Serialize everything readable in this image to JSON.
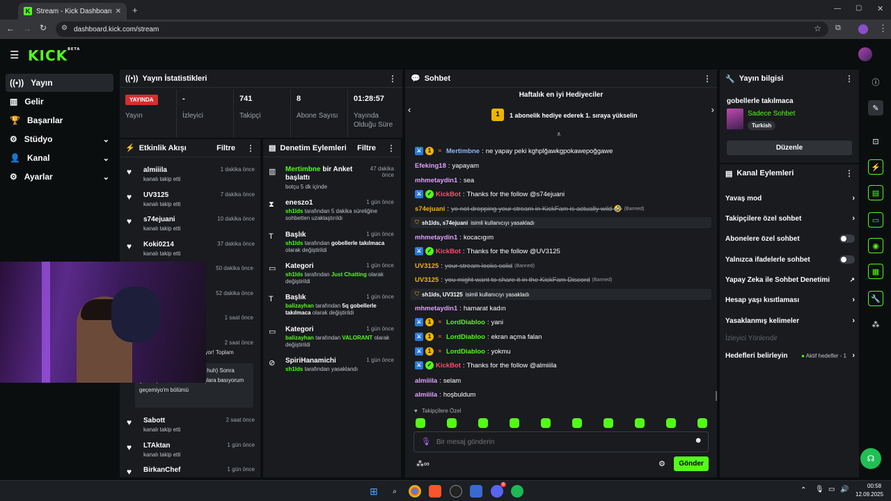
{
  "browser": {
    "tab_title": "Stream - Kick Dashboard",
    "url": "dashboard.kick.com/stream"
  },
  "header": {
    "logo": "KICK",
    "logo_sup": "BETA"
  },
  "nav": {
    "items": [
      {
        "label": "Yayın",
        "icon": "broadcast-icon"
      },
      {
        "label": "Gelir",
        "icon": "chart-icon"
      },
      {
        "label": "Başarılar",
        "icon": "trophy-icon"
      },
      {
        "label": "Stüdyo",
        "icon": "gear-icon"
      },
      {
        "label": "Kanal",
        "icon": "person-icon"
      },
      {
        "label": "Ayarlar",
        "icon": "settings-icon"
      }
    ]
  },
  "stats": {
    "title": "Yayın İstatistikleri",
    "live_badge": "YAYINDA",
    "live_label": "Yayın",
    "viewers_value": "-",
    "viewers_label": "İzleyici",
    "followers_value": "741",
    "followers_label": "Takipçi",
    "subs_value": "8",
    "subs_label": "Abone Sayısı",
    "uptime_value": "01:28:57",
    "uptime_label": "Yayında Olduğu Süre"
  },
  "activity": {
    "title": "Etkinlik Akışı",
    "filter": "Filtre",
    "items": [
      {
        "name": "almiiila",
        "sub": "kanalı takip etti",
        "time": "1 dakika önce"
      },
      {
        "name": "UV3125",
        "sub": "kanalı takip etti",
        "time": "7 dakika önce"
      },
      {
        "name": "s74ejuani",
        "sub": "kanalı takip etti",
        "time": "10 dakika önce"
      },
      {
        "name": "Koki0214",
        "sub": "kanalı takip etti",
        "time": "37 dakika önce"
      }
    ],
    "hidden_times": [
      "50 dakika önce",
      "52 dakika önce",
      "1 saat önce",
      "2 saat önce"
    ],
    "partial_tail": "uyor! Toplam",
    "msg_text": "yo' kömürü iki dönümü (Uh huh) Sonra göremiyom önümü Tüm tuşlara basıyorum geçemiyo'm bölümü",
    "items_bottom": [
      {
        "name": "Sabott",
        "sub": "kanalı takip etti",
        "time": "2 saat önce"
      },
      {
        "name": "LTAktan",
        "sub": "kanalı takip etti",
        "time": "1 gün önce"
      },
      {
        "name": "BirkanChef",
        "sub": "",
        "time": "1 gün önce"
      }
    ]
  },
  "moderation": {
    "title": "Denetim Eylemleri",
    "filter": "Filtre",
    "items": [
      {
        "title_g": "Mertimbne",
        "title": " bir Anket başlattı",
        "sub": "botçu 5 dk içinde",
        "time": "47 dakika önce"
      },
      {
        "title": "eneszo1",
        "sub_g": "sh1lds",
        "sub": " tarafından 5 dakika süreliğine sohbetten uzaklaştırıldı",
        "time": "1 gün önce"
      },
      {
        "title": "Başlık",
        "sub_g": "sh1lds",
        "sub": " tarafından ",
        "sub_b": "gobellerle takılmaca",
        "sub2": " olarak değiştirildi",
        "time": "1 gün önce"
      },
      {
        "title": "Kategori",
        "sub_g": "sh1lds",
        "sub": " tarafından ",
        "sub_gb": "Just Chatting",
        "sub2": " olarak değiştirildi",
        "time": "1 gün önce"
      },
      {
        "title": "Başlık",
        "sub_g": "balizayhan",
        "sub": " tarafından ",
        "sub_b": "5q gobellerle takılmaca",
        "sub2": " olarak değiştirildi",
        "time": "1 gün önce"
      },
      {
        "title": "Kategori",
        "sub_g": "balizayhan",
        "sub": " tarafından ",
        "sub_gb": "VALORANT",
        "sub2": " olarak değiştirildi",
        "time": "1 gün önce"
      },
      {
        "title": "SpiriHanamichi",
        "sub_g": "sh1lds",
        "sub": " tarafından yasaklandı",
        "time": "1 gün önce"
      }
    ]
  },
  "chat": {
    "title": "Sohbet",
    "gifters_title": "Haftalık en iyi Hediyeciler",
    "gifters_rank": "1",
    "gifters_text": "1 abonelik hediye ederek 1. sıraya yükselin",
    "messages": [
      {
        "user": "Mertimbne",
        "text": "ne yapay peki kghplğawkgpokawepoğgawe",
        "color": "#8fb8ff",
        "badges": "modsubgift"
      },
      {
        "user": "Efeking18",
        "text": "yapayam",
        "color": "#e0a0ff",
        "badges": ""
      },
      {
        "user": "mhmetaydin1",
        "text": "sea",
        "color": "#e0a0ff",
        "badges": ""
      },
      {
        "user": "KickBot",
        "text": "Thanks for the follow @s74ejuani",
        "color": "#ff4d6d",
        "badges": "modver"
      },
      {
        "user": "s74ejuani",
        "text": "yo not dropping your stream in KickFam is actually wild 🤣",
        "color": "#f0b400",
        "badges": "",
        "deleted": true
      },
      {
        "user": "mhmetaydin1",
        "text": "kocacıgım",
        "color": "#e0a0ff",
        "badges": ""
      },
      {
        "user": "KickBot",
        "text": "Thanks for the follow @UV3125",
        "color": "#ff4d6d",
        "badges": "modver"
      },
      {
        "user": "UV3125",
        "text": "your stream looks solid",
        "color": "#f0b400",
        "badges": "",
        "deleted": true
      },
      {
        "user": "UV3125",
        "text": "you might want to share it in the KickFam Discord",
        "color": "#f0b400",
        "badges": "",
        "deleted": true
      },
      {
        "user": "mhmetaydin1",
        "text": "hamarat kadın",
        "color": "#e0a0ff",
        "badges": ""
      },
      {
        "user": "LordDiabloo",
        "text": "yani",
        "color": "#53fc18",
        "badges": "modsubgift"
      },
      {
        "user": "LordDiabloo",
        "text": "ekran açma falan",
        "color": "#53fc18",
        "badges": "modsubgift"
      },
      {
        "user": "LordDiabloo",
        "text": "yokmu",
        "color": "#53fc18",
        "badges": "modsubgift"
      },
      {
        "user": "KickBot",
        "text": "Thanks for the follow @almiiila",
        "color": "#ff4d6d",
        "badges": "modver"
      },
      {
        "user": "almiiila",
        "text": "selam",
        "color": "#e0a0ff",
        "badges": ""
      },
      {
        "user": "almiiila",
        "text": "hoşbuldum",
        "color": "#e0a0ff",
        "badges": ""
      }
    ],
    "banned_label": "(Banned)",
    "sys1_users": "sh1lds, s74ejuani",
    "sys1_text": " isimli kullanıcıyı yasakladı",
    "sys2_users": "sh1lds, UV3125",
    "sys2_text": " isimli kullanıcıyı yasakladı",
    "followers_only": "Takipçilere Özel",
    "input_placeholder": "Bir mesaj gönderin",
    "send": "Gönder"
  },
  "stream_info": {
    "title": "Yayın bilgisi",
    "stream_title": "gobellerle takılmaca",
    "category": "Sadece Sohbet",
    "language": "Turkish",
    "edit": "Düzenle"
  },
  "channel_actions": {
    "title": "Kanal Eylemleri",
    "slow_mode": "Yavaş mod",
    "followers_chat": "Takipçilere özel sohbet",
    "subs_chat": "Abonelere özel sohbet",
    "emotes_chat": "Yalnızca ifadelerle sohbet",
    "ai_mod": "Yapay Zeka ile Sohbet Denetimi",
    "age_restrict": "Hesap yaşı kısıtlaması",
    "banned_words": "Yasaklanmış kelimeler",
    "viewer_redirect": "İzleyici Yönlendir",
    "goals": "Hedefleri belirleyin",
    "goals_status": "Aktif hedefler - 1"
  },
  "taskbar": {
    "time": "00:58",
    "date": "12.09.2025",
    "discord_badge": "8"
  },
  "colors": {
    "accent": "#53fc18",
    "panel": "#191b1f",
    "bg": "#0b0e0f"
  }
}
